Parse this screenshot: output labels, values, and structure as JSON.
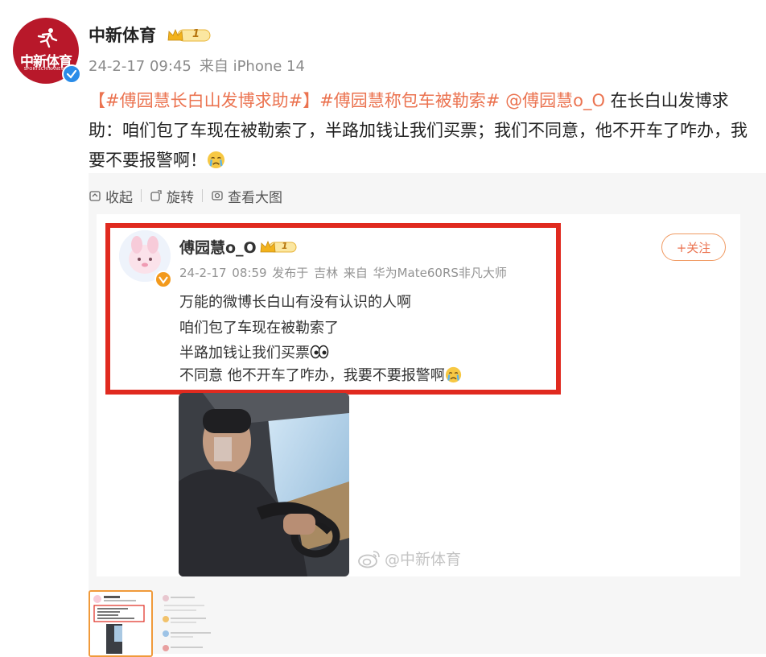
{
  "post": {
    "author": "中新体育",
    "avatar_text": "中新体育",
    "avatar_subtext": "SPORTSCHINANEWS",
    "level_badge": "1",
    "date": "24-2-17 09:45",
    "source": "来自 iPhone 14",
    "body": {
      "tag1": "【#傅园慧长白山发博求助#】",
      "tag2": "#傅园慧称包车被勒索#",
      "mention": "@傅园慧o_O",
      "text": "在长白山发博求助：咱们包了车现在被勒索了，半路加钱让我们买票；我们不同意，他不开车了咋办，我要不要报警啊！"
    }
  },
  "actions": {
    "collapse": "收起",
    "rotate": "旋转",
    "view_large": "查看大图"
  },
  "screenshot": {
    "name": "傅园慧o_O",
    "level_badge": "1",
    "meta": "24-2-17 08:59 发布于 吉林 来自 华为Mate60RS非凡大师",
    "follow_label": "+关注",
    "lines": [
      "万能的微博长白山有没有认识的人啊",
      "咱们包了车现在被勒索了",
      "半路加钱让我们买票",
      "不同意 他不开车了咋办，我要不要报警啊"
    ],
    "watermark": "@中新体育"
  },
  "colors": {
    "accent": "#eb7350",
    "highlight_box": "#e02a1f",
    "brand_red": "#b8182a"
  }
}
